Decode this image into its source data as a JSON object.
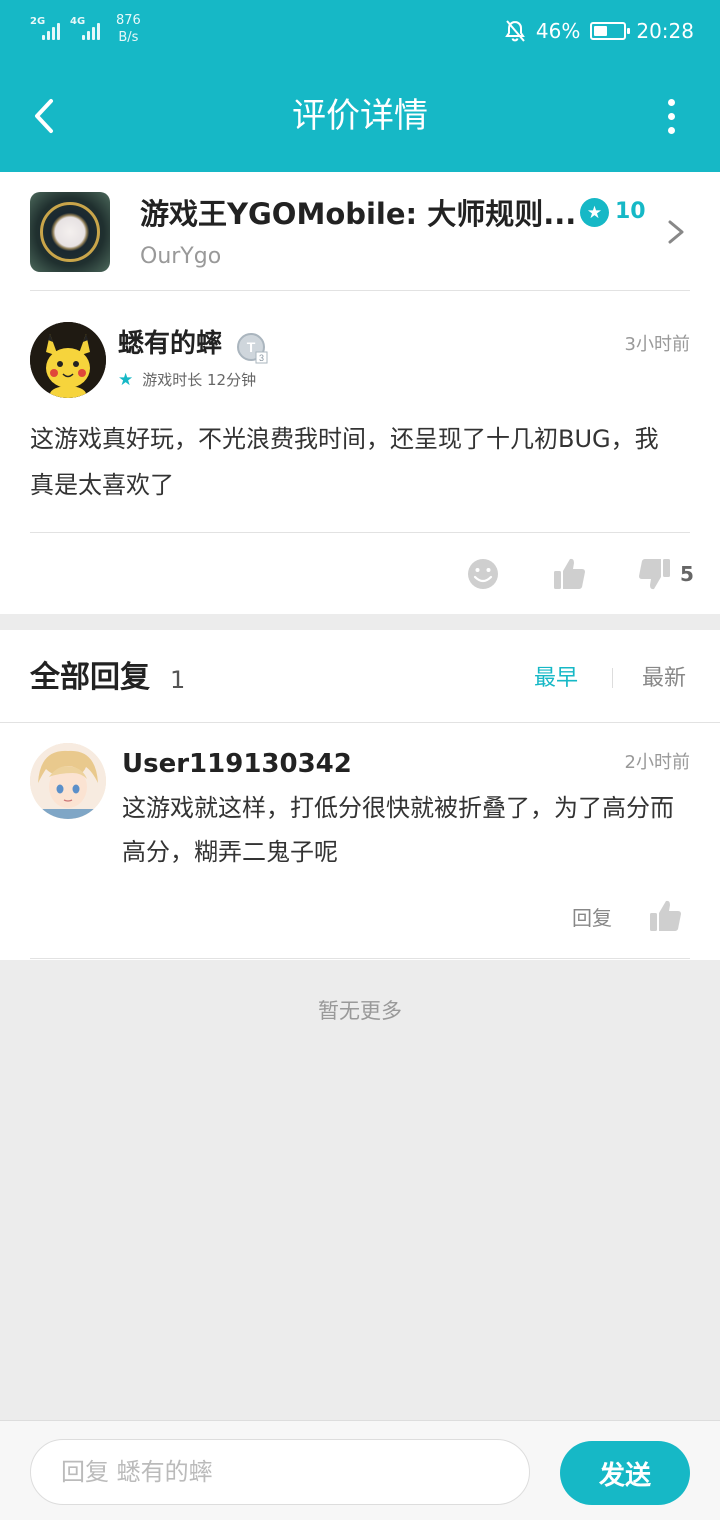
{
  "colors": {
    "accent": "#16b8c6",
    "background": "#ececec"
  },
  "status_bar": {
    "signal1_label": "2G",
    "signal2_label": "4G",
    "net_speed_value": "876",
    "net_speed_unit": "B/s",
    "battery": "46%",
    "battery_level": 0.46,
    "time": "20:28",
    "icons": [
      "signal-icon",
      "signal-icon",
      "mute-icon",
      "battery-icon"
    ]
  },
  "nav": {
    "title": "评价详情",
    "back_icon": "back-arrow-icon",
    "more_icon": "more-vertical-icon"
  },
  "app": {
    "name": "游戏王YGOMobile: 大师规则...",
    "developer": "OurYgo",
    "score": "10",
    "score_icon": "star-badge-icon"
  },
  "review": {
    "username": "蟋有的蟀",
    "level_badge": "T",
    "level_number": "3",
    "time": "3小时前",
    "playtime": "游戏时长 12分钟",
    "text": "这游戏真好玩，不光浪费我时间，还呈现了十几初BUG，我真是太喜欢了",
    "dislike_count": "5"
  },
  "replies": {
    "title": "全部回复",
    "count": "1",
    "sort_earliest": "最早",
    "sort_newest": "最新",
    "items": [
      {
        "user": "User119130342",
        "time": "2小时前",
        "text": "这游戏就这样，打低分很快就被折叠了，为了高分而高分，糊弄二鬼子呢",
        "reply_label": "回复"
      }
    ],
    "no_more": "暂无更多"
  },
  "bottom": {
    "placeholder": "回复 蟋有的蟀",
    "send_label": "发送"
  }
}
